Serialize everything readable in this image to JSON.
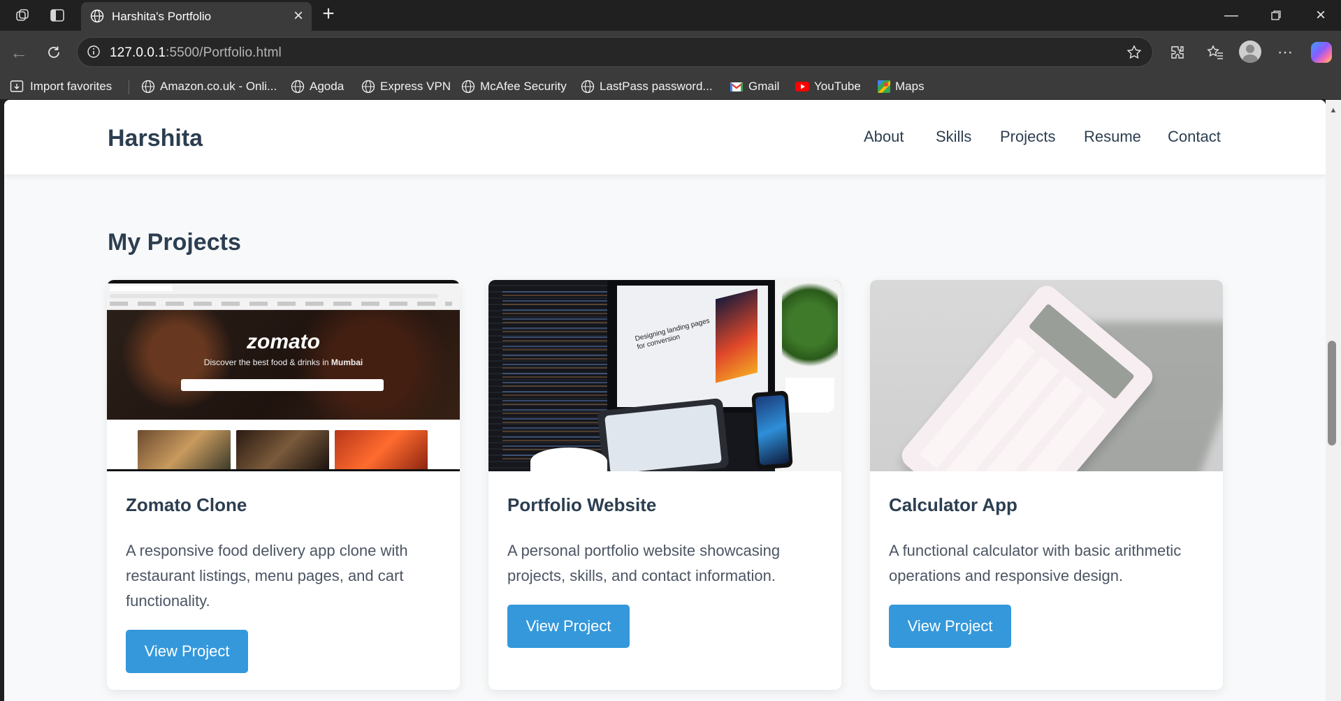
{
  "browser": {
    "tab_title": "Harshita's Portfolio",
    "url_host": "127.0.0.1",
    "url_rest": ":5500/Portfolio.html",
    "bookmarks": [
      {
        "label": "Import favorites",
        "icon": "import-icon"
      },
      {
        "label": "Amazon.co.uk - Onli...",
        "icon": "globe-icon"
      },
      {
        "label": "Agoda",
        "icon": "globe-icon"
      },
      {
        "label": "Express VPN",
        "icon": "globe-icon"
      },
      {
        "label": "McAfee Security",
        "icon": "globe-icon"
      },
      {
        "label": "LastPass password...",
        "icon": "globe-icon"
      },
      {
        "label": "Gmail",
        "icon": "gmail-icon"
      },
      {
        "label": "YouTube",
        "icon": "youtube-icon"
      },
      {
        "label": "Maps",
        "icon": "maps-icon"
      }
    ]
  },
  "site": {
    "brand": "Harshita",
    "nav": [
      {
        "label": "About"
      },
      {
        "label": "Skills"
      },
      {
        "label": "Projects"
      },
      {
        "label": "Resume"
      },
      {
        "label": "Contact"
      }
    ],
    "section_title": "My Projects",
    "projects": [
      {
        "title": "Zomato Clone",
        "description": "A responsive food delivery app clone with restaurant listings, menu pages, and cart functionality.",
        "button": "View Project",
        "image_brand": "zomato",
        "image_tagline_pre": "Discover the best food & drinks in ",
        "image_tagline_city": "Mumbai"
      },
      {
        "title": "Portfolio Website",
        "description": "A personal portfolio website showcasing projects, skills, and contact information.",
        "button": "View Project",
        "image_text": "Designing landing pages for conversion"
      },
      {
        "title": "Calculator App",
        "description": "A functional calculator with basic arithmetic operations and responsive design.",
        "button": "View Project"
      }
    ]
  },
  "colors": {
    "accent": "#3498db",
    "heading": "#2c3e50",
    "page_bg": "#f8f9fa"
  }
}
